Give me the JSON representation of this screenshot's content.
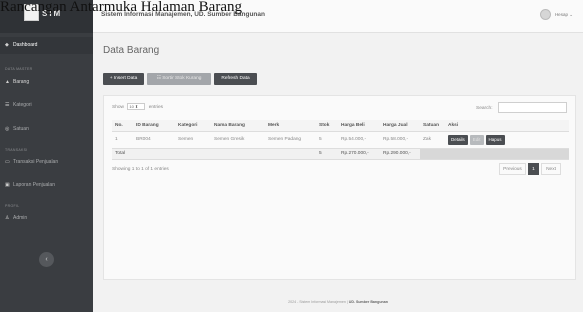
{
  "caption": "Rancangan Antarmuka Halaman Barang",
  "sidebar": {
    "brand": "SIM",
    "items": [
      {
        "label": "Dashboard",
        "icon": "dashboard-icon"
      },
      {
        "label": "Barang",
        "icon": "box-icon"
      },
      {
        "label": "Kategori",
        "icon": "tag-icon"
      },
      {
        "label": "Satuan",
        "icon": "scale-icon"
      },
      {
        "label": "Transaksi Penjualan",
        "icon": "cart-icon"
      },
      {
        "label": "Laporan Penjualan",
        "icon": "report-icon"
      },
      {
        "label": "Admin",
        "icon": "user-icon"
      }
    ],
    "headings": {
      "data_master": "DATA MASTER",
      "transaksi": "TRANSAKSI",
      "profil": "PROFIL"
    },
    "toggle_icon": "chevron-left-icon"
  },
  "topbar": {
    "title": "Sistem Informasi Manajemen, UD. Sumber Bangunan",
    "user_name": "Hesap"
  },
  "page": {
    "title": "Data Barang",
    "buttons": {
      "insert": "+ Insert Data",
      "stock_sort": "Sortir Stok Kurang",
      "refresh": "Refresh Data"
    },
    "show_label_pre": "Show",
    "entries_value": "10",
    "show_label_post": "entries",
    "search_label": "Search:",
    "search_value": ""
  },
  "table": {
    "headers": [
      "No.",
      "ID Barang",
      "Kategori",
      "Nama Barang",
      "Merk",
      "Stok",
      "Harga Beli",
      "Harga Jual",
      "Satuan",
      "Aksi"
    ],
    "rows": [
      [
        "1",
        "BR004",
        "Semen",
        "Semen Gresik",
        "Semen Padang",
        "5",
        "Rp.54.000,-",
        "Rp.58.000,-",
        "Zak"
      ]
    ],
    "actions": {
      "details": "Details",
      "edit": "Edit",
      "delete": "Hapus"
    },
    "total": {
      "label": "Total",
      "stok": "5",
      "harga_beli": "Rp.270.000,-",
      "harga_jual": "Rp.290.000,-"
    }
  },
  "pagination": {
    "info": "Showing 1 to 1 of 1 entries",
    "previous": "Previous",
    "current": "1",
    "next": "Next"
  },
  "footer": {
    "text": "2024 - Sistem Informasi Manajemen |",
    "strong": "UD. Sumber Bangunan"
  },
  "colors": {
    "sidebar": "#3a3d41",
    "accent": "#4b4e52",
    "background": "#f2f2f2"
  }
}
